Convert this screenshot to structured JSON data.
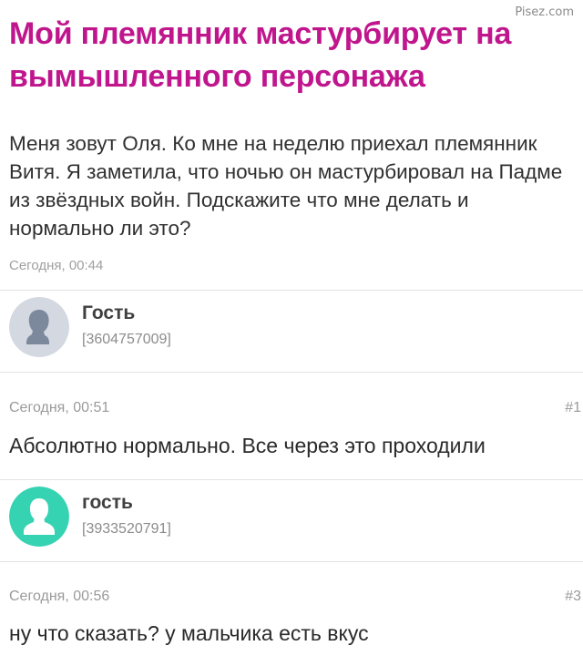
{
  "watermark": "Pisez.com",
  "question": {
    "title": "Мой племянник мастурбирует на вымышленного персонажа",
    "text": "Меня зовут Оля. Ко мне на неделю приехал племянник Витя. Я заметила, что ночью он мастурбировал на Падме из звёздных войн. Подскажите что мне делать и нормально ли это?",
    "time": "Сегодня, 00:44"
  },
  "comments": [
    {
      "author": "Гость",
      "author_id": "[3604757009]",
      "avatar_color": "#d3d8e1",
      "avatar_figure_color": "#7c889c",
      "time": "Сегодня, 00:51",
      "number": "#1",
      "text": "Абсолютно нормально. Все через это проходили"
    },
    {
      "author": "гость",
      "author_id": "[3933520791]",
      "avatar_color": "#36d3b3",
      "avatar_figure_color": "#ffffff",
      "time": "Сегодня, 00:56",
      "number": "#3",
      "text": "ну что сказать? у мальчика есть вкус"
    }
  ],
  "colors": {
    "title": "#c0168d",
    "meta": "#9a9a9a",
    "divider": "#e3e3e3"
  }
}
